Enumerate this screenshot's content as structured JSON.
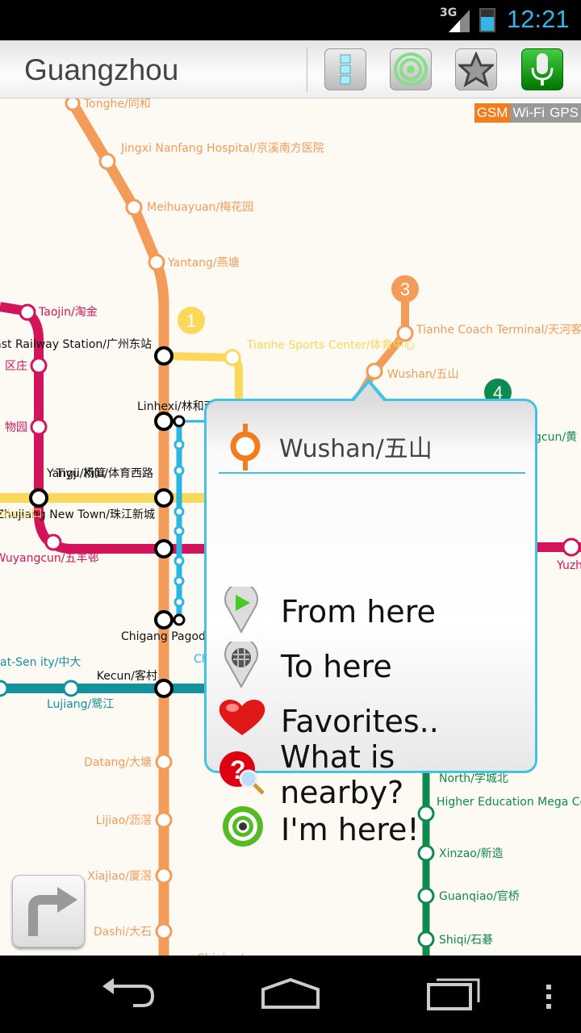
{
  "status_bar": {
    "network": "3G",
    "time": "12:21"
  },
  "app_bar": {
    "title": "Guangzhou",
    "buttons": [
      "lines-icon",
      "locate-icon",
      "favorites-star-icon",
      "voice-mic-icon"
    ]
  },
  "location_modes": {
    "gsm": "GSM",
    "wifi": "Wi-Fi",
    "gps": "GPS",
    "active": "GSM",
    "active_color": "#f07d1e"
  },
  "line_badges": {
    "line1": "1",
    "line3": "3",
    "line4": "4"
  },
  "colors": {
    "line1": "#fad85a",
    "line3": "#f39c5a",
    "line4": "#0e8a4e",
    "line5": "#d4145a",
    "line8": "#13929e",
    "apm": "#29b6e0"
  },
  "stations": [
    {
      "label": "Tonghe/同和",
      "line": "line3"
    },
    {
      "label": "Jingxi Nanfang Hospital/京溪南方医院",
      "line": "line3"
    },
    {
      "label": "Meihuayuan/梅花园",
      "line": "line3"
    },
    {
      "label": "Yantang/燕塘",
      "line": "line3"
    },
    {
      "label": "Taojin/淘金",
      "line": "line5"
    },
    {
      "label": "Guangzhou East Railway Station/广州东站",
      "line": "interchange"
    },
    {
      "label": "Tianhe Sports Center/体育中心",
      "line": "line1"
    },
    {
      "label": "Tianhe Coach Terminal/天河客运站",
      "line": "line3"
    },
    {
      "label": "Wushan/五山",
      "line": "line3"
    },
    {
      "label": "区庄",
      "line": "line5"
    },
    {
      "label": "物园",
      "line": "line5"
    },
    {
      "label": "Linhexi/林和西",
      "line": "interchange"
    },
    {
      "label": "Yangji/杨箕",
      "line": "interchange"
    },
    {
      "label": "Tiyu Xilu/体育西路",
      "line": "interchange"
    },
    {
      "label": "Zhujiang New Town/珠江新城",
      "line": "interchange"
    },
    {
      "label": "nkou/口",
      "line": "line1"
    },
    {
      "label": "Wuyangcun/五羊邨",
      "line": "line5"
    },
    {
      "label": "Chigang Pagoda",
      "line": "interchange"
    },
    {
      "label": "at-Sen ity/中大",
      "line": "line8"
    },
    {
      "label": "Kecun/客村",
      "line": "interchange"
    },
    {
      "label": "Lujiang/鹭江",
      "line": "line8"
    },
    {
      "label": "Datang/大塘",
      "line": "line3"
    },
    {
      "label": "Lijiao/沥滘",
      "line": "line3"
    },
    {
      "label": "Xiajiao/厦滘",
      "line": "line3"
    },
    {
      "label": "Dashi/大石",
      "line": "line3"
    },
    {
      "label": "North/学城北",
      "line": "line4"
    },
    {
      "label": "Higher Education Mega Center South/大学城南",
      "line": "line4"
    },
    {
      "label": "Xinzao/新造",
      "line": "line4"
    },
    {
      "label": "Guanqiao/官桥",
      "line": "line4"
    },
    {
      "label": "Shiqi/石碁",
      "line": "line4"
    },
    {
      "label": "Yuzh/",
      "line": "line5"
    },
    {
      "label": "gcun/黄",
      "line": "line4"
    },
    {
      "label": "Ch",
      "line": "apm"
    },
    {
      "label": "Shiqiao/",
      "line": "line3"
    }
  ],
  "popup": {
    "station": "Wushan/五山",
    "items": [
      {
        "label": "From here",
        "icon": "green-start-pin-icon"
      },
      {
        "label": "To here",
        "icon": "checkered-finish-pin-icon"
      },
      {
        "label": "Favorites..",
        "icon": "heart-icon"
      },
      {
        "label": "What is nearby?",
        "icon": "question-magnifier-icon"
      },
      {
        "label": "I'm here!",
        "icon": "target-icon"
      }
    ]
  },
  "navigation": [
    "back-icon",
    "home-icon",
    "recents-icon",
    "menu-icon"
  ]
}
